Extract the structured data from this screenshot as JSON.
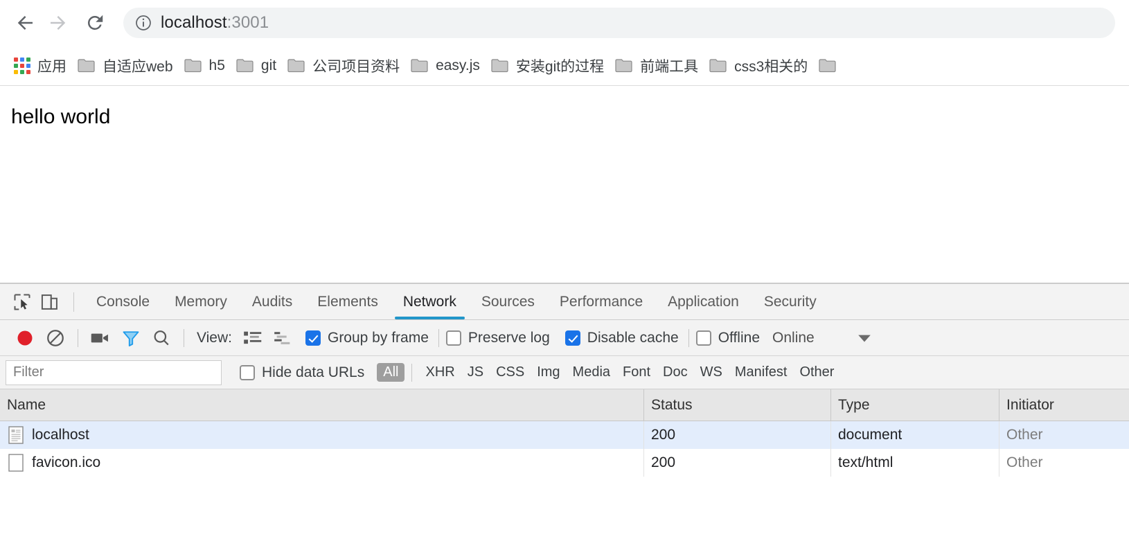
{
  "browser": {
    "nav": {
      "back_icon": "arrow-left-icon",
      "forward_icon": "arrow-right-icon",
      "reload_icon": "reload-icon"
    },
    "omnibox": {
      "info_icon": "info-circle-icon",
      "url_host": "localhost",
      "url_port": ":3001",
      "full_url": "localhost:3001"
    },
    "bookmarks": [
      {
        "label": "应用",
        "icon": "apps-grid-icon"
      },
      {
        "label": "自适应web",
        "icon": "folder-icon"
      },
      {
        "label": "h5",
        "icon": "folder-icon"
      },
      {
        "label": "git",
        "icon": "folder-icon"
      },
      {
        "label": "公司项目资料",
        "icon": "folder-icon"
      },
      {
        "label": "easy.js",
        "icon": "folder-icon"
      },
      {
        "label": "安装git的过程",
        "icon": "folder-icon"
      },
      {
        "label": "前端工具",
        "icon": "folder-icon"
      },
      {
        "label": "css3相关的",
        "icon": "folder-icon"
      },
      {
        "label": "",
        "icon": "folder-icon"
      }
    ]
  },
  "page": {
    "content_text": "hello world"
  },
  "devtools": {
    "inspect_icon": "inspect-element-icon",
    "device_icon": "device-toolbar-icon",
    "tabs": [
      {
        "label": "Console",
        "active": false
      },
      {
        "label": "Memory",
        "active": false
      },
      {
        "label": "Audits",
        "active": false
      },
      {
        "label": "Elements",
        "active": false
      },
      {
        "label": "Network",
        "active": true
      },
      {
        "label": "Sources",
        "active": false
      },
      {
        "label": "Performance",
        "active": false
      },
      {
        "label": "Application",
        "active": false
      },
      {
        "label": "Security",
        "active": false
      }
    ],
    "network_toolbar": {
      "record_icon": "record-button-icon",
      "clear_icon": "clear-icon",
      "capture_screenshots_icon": "camera-icon",
      "filter_icon": "funnel-filter-icon",
      "search_icon": "search-icon",
      "view_label": "View:",
      "view_list_icon": "list-view-icon",
      "view_waterfall_icon": "waterfall-view-icon",
      "group_by_frame": {
        "label": "Group by frame",
        "checked": true
      },
      "preserve_log": {
        "label": "Preserve log",
        "checked": false
      },
      "disable_cache": {
        "label": "Disable cache",
        "checked": true
      },
      "offline": {
        "label": "Offline",
        "checked": false
      },
      "throttling": {
        "value": "Online",
        "caret_icon": "chevron-down-icon"
      }
    },
    "filter_row": {
      "filter_placeholder": "Filter",
      "filter_value": "",
      "hide_data_urls": {
        "label": "Hide data URLs",
        "checked": false
      },
      "types": [
        {
          "label": "All",
          "selected": true
        },
        {
          "label": "XHR",
          "selected": false
        },
        {
          "label": "JS",
          "selected": false
        },
        {
          "label": "CSS",
          "selected": false
        },
        {
          "label": "Img",
          "selected": false
        },
        {
          "label": "Media",
          "selected": false
        },
        {
          "label": "Font",
          "selected": false
        },
        {
          "label": "Doc",
          "selected": false
        },
        {
          "label": "WS",
          "selected": false
        },
        {
          "label": "Manifest",
          "selected": false
        },
        {
          "label": "Other",
          "selected": false
        }
      ]
    },
    "requests_table": {
      "columns": [
        "Name",
        "Status",
        "Type",
        "Initiator"
      ],
      "rows": [
        {
          "name": "localhost",
          "status": "200",
          "type": "document",
          "initiator": "Other",
          "selected": true,
          "icon": "document-lines-icon"
        },
        {
          "name": "favicon.ico",
          "status": "200",
          "type": "text/html",
          "initiator": "Other",
          "selected": false,
          "icon": "document-blank-icon"
        }
      ]
    }
  },
  "colors": {
    "accent_blue": "#1a73e8",
    "tab_underline": "#2196c9",
    "record_red": "#e0202a",
    "filter_active_blue": "#3b9cf0",
    "selected_row": "#e3edfc",
    "devtools_bg": "#f3f3f3",
    "header_bg": "#e6e6e6"
  }
}
